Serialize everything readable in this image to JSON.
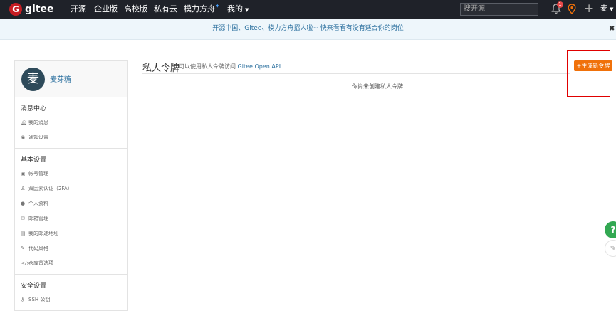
{
  "brand": {
    "name": "gitee",
    "logo_letter": "G"
  },
  "nav": {
    "items": [
      {
        "label": "开源"
      },
      {
        "label": "企业版"
      },
      {
        "label": "高校版"
      },
      {
        "label": "私有云"
      },
      {
        "label": "模力方舟"
      },
      {
        "label": "我的"
      }
    ],
    "search_placeholder": "搜开源",
    "notification_count": "1",
    "plus": "+",
    "user_initial": "麦"
  },
  "banner": {
    "text": "开源中国、Gitee、模力方舟招人啦~ 快来看看有没有适合你的岗位",
    "close": "✖"
  },
  "sidebar": {
    "username": "麦芽糖",
    "avatar_letter": "麦",
    "sections": [
      {
        "title": "消息中心",
        "items": [
          {
            "icon": "bell-icon",
            "label": "我的消息"
          },
          {
            "icon": "cast-icon",
            "label": "通知设置"
          }
        ]
      },
      {
        "title": "基本设置",
        "items": [
          {
            "icon": "id-card-icon",
            "label": "帐号管理"
          },
          {
            "icon": "users-icon",
            "label": "双因素认证（2FA）"
          },
          {
            "icon": "user-icon",
            "label": "个人资料"
          },
          {
            "icon": "mail-icon",
            "label": "邮箱管理"
          },
          {
            "icon": "address-icon",
            "label": "我的邮递地址"
          },
          {
            "icon": "brush-icon",
            "label": "代码风格"
          },
          {
            "icon": "code-icon",
            "label": "仓库首选项"
          }
        ]
      },
      {
        "title": "安全设置",
        "items": [
          {
            "icon": "key-icon",
            "label": "SSH 公钥"
          }
        ]
      }
    ]
  },
  "main": {
    "title": "私人令牌",
    "subtitle_prefix": "可以使用私人令牌访问",
    "subtitle_link": "Gitee Open API",
    "empty_text": "你尚未创建私人令牌",
    "generate_button": "+生成新令牌"
  },
  "float": {
    "help": "?",
    "edit": "✎"
  },
  "colors": {
    "nav_bg": "#1f2229",
    "accent": "#f0710a",
    "link": "#2a6f9e",
    "brand_red": "#c71d23"
  }
}
